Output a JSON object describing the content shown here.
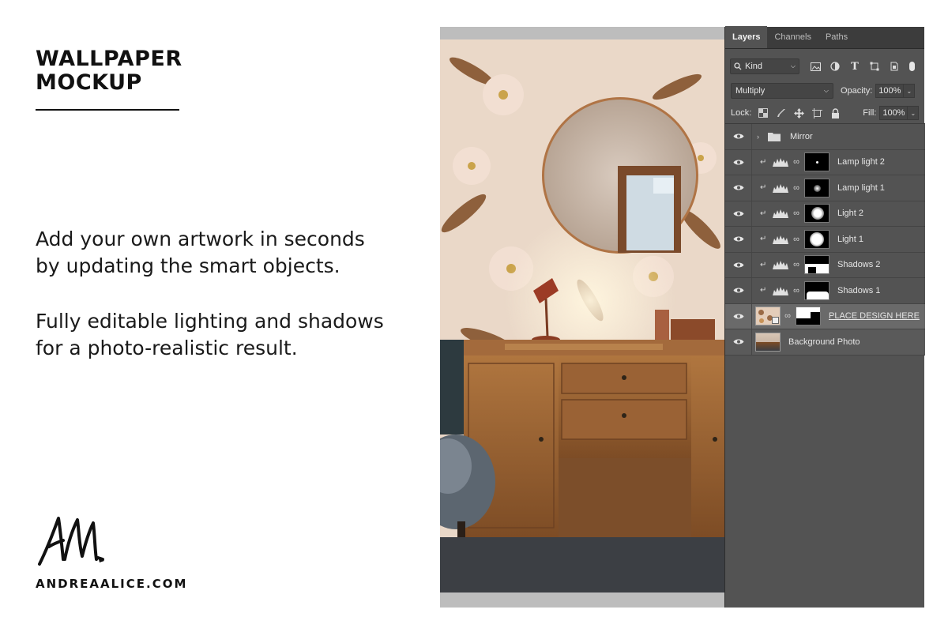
{
  "heading": {
    "line1": "WALLPAPER",
    "line2": "MOCKUP"
  },
  "paragraphs": {
    "p1_line1": "Add your own artwork in seconds",
    "p1_line2": "by updating the smart objects.",
    "p2_line1": "Fully editable lighting and shadows",
    "p2_line2": "for a photo-realistic result."
  },
  "brand": {
    "url": "ANDREAALICE.COM",
    "signature_icon": "handwritten-am-signature"
  },
  "panel": {
    "tabs": [
      {
        "label": "Layers",
        "active": true
      },
      {
        "label": "Channels",
        "active": false
      },
      {
        "label": "Paths",
        "active": false
      }
    ],
    "filter": {
      "kind_label": "Kind",
      "icons": [
        "image-filter-icon",
        "adjustment-filter-icon",
        "type-filter-icon",
        "shape-filter-icon",
        "smart-object-filter-icon"
      ]
    },
    "blend_mode": "Multiply",
    "opacity_label": "Opacity:",
    "opacity_value": "100%",
    "lock_label": "Lock:",
    "lock_icons": [
      "lock-transparent-icon",
      "lock-paint-icon",
      "lock-move-icon",
      "lock-artboard-icon",
      "lock-all-icon"
    ],
    "fill_label": "Fill:",
    "fill_value": "100%",
    "layers": [
      {
        "name": "Mirror",
        "kind": "group"
      },
      {
        "name": "Lamp light 2",
        "kind": "adjustment"
      },
      {
        "name": "Lamp light 1",
        "kind": "adjustment"
      },
      {
        "name": "Light 2",
        "kind": "adjustment"
      },
      {
        "name": "Light 1",
        "kind": "adjustment"
      },
      {
        "name": "Shadows 2",
        "kind": "adjustment"
      },
      {
        "name": "Shadows 1",
        "kind": "adjustment"
      },
      {
        "name": "PLACE DESIGN HERE",
        "kind": "smart-object",
        "selected": true
      },
      {
        "name": "Background Photo",
        "kind": "background"
      }
    ]
  },
  "colors": {
    "panel_bg": "#535353",
    "tab_bar_bg": "#3c3c3c",
    "selected_layer_bg": "#6a6a6a",
    "text_dark": "#111111"
  }
}
